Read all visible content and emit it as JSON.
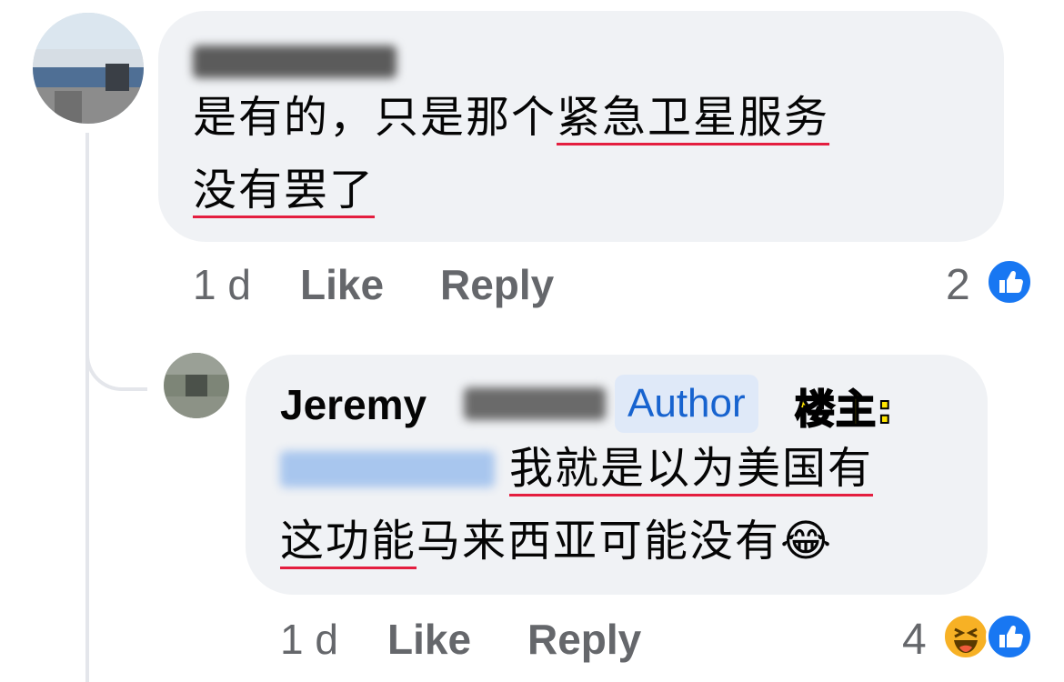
{
  "comment1": {
    "text_line1_plain": "是有的，只是那个",
    "text_line1_underlined": "紧急卫星服务",
    "text_line2_underlined": "没有罢了",
    "time": "1 d",
    "like_label": "Like",
    "reply_label": "Reply",
    "reaction_count": "2",
    "reaction_icons": [
      "like-icon"
    ]
  },
  "comment2": {
    "author_name": "Jeremy",
    "author_badge": "Author",
    "annotation_label": "楼主:",
    "text_line1_underlined": "我就是以为美国有",
    "text_line2_underlined": "这功能",
    "text_line2_plain": "马来西亚可能没有😂",
    "time": "1 d",
    "like_label": "Like",
    "reply_label": "Reply",
    "reaction_count": "4",
    "reaction_icons": [
      "haha-icon",
      "like-icon"
    ]
  },
  "colors": {
    "bubble": "#f0f2f5",
    "meta_text": "#65676b",
    "underline": "#e41e3f",
    "like_blue": "#1877f2",
    "author_badge_bg": "#dfe9f8",
    "author_badge_text": "#1763cf",
    "annotation_yellow": "#ffe500"
  }
}
